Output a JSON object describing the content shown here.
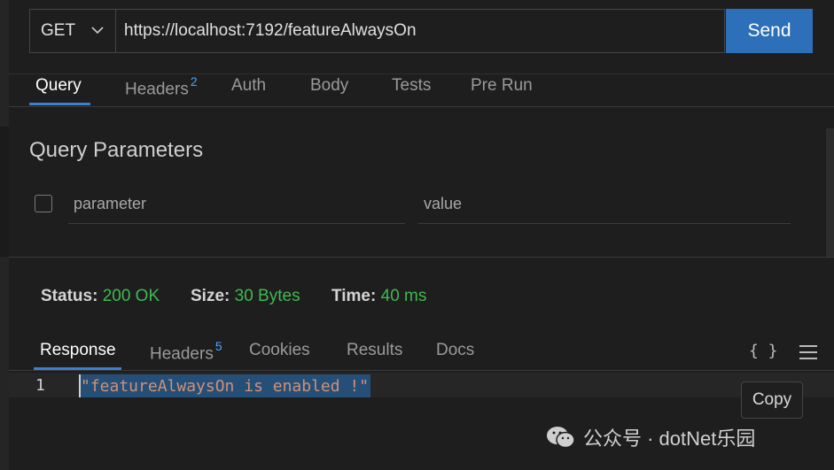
{
  "request": {
    "method": "GET",
    "url": "https://localhost:7192/featureAlwaysOn",
    "send_label": "Send"
  },
  "request_tabs": [
    {
      "label": "Query",
      "active": true
    },
    {
      "label": "Headers",
      "badge": "2"
    },
    {
      "label": "Auth"
    },
    {
      "label": "Body"
    },
    {
      "label": "Tests"
    },
    {
      "label": "Pre Run"
    }
  ],
  "query": {
    "title": "Query Parameters",
    "param_placeholder": "parameter",
    "value_placeholder": "value"
  },
  "status": {
    "status_label": "Status:",
    "status_value": "200 OK",
    "size_label": "Size:",
    "size_value": "30 Bytes",
    "time_label": "Time:",
    "time_value": "40 ms"
  },
  "response_tabs": [
    {
      "label": "Response",
      "active": true
    },
    {
      "label": "Headers",
      "badge": "5"
    },
    {
      "label": "Cookies"
    },
    {
      "label": "Results"
    },
    {
      "label": "Docs"
    }
  ],
  "response_actions": {
    "braces": "{ }",
    "copy_label": "Copy"
  },
  "editor": {
    "line_number": "1",
    "content": "\"featureAlwaysOn is enabled !\""
  },
  "watermark": {
    "text": "公众号 · dotNet乐园"
  },
  "colors": {
    "accent": "#2d6fb8",
    "status_green": "#3fb950",
    "badge_blue": "#4da3ff",
    "string_orange": "#ce9178"
  }
}
